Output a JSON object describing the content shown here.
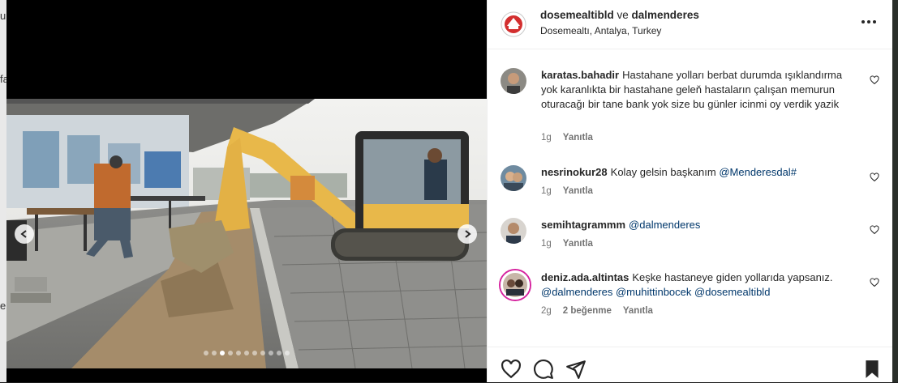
{
  "backdrop": {
    "glyphs": [
      "u",
      "fa",
      "e"
    ]
  },
  "media": {
    "carousel_dots_total": 11,
    "carousel_active_index": 2,
    "prev_label": "previous-slide",
    "next_label": "next-slide"
  },
  "header": {
    "author": "dosemealtibld",
    "conjunction": " ve ",
    "coauthor": "dalmenderes",
    "location": "Dosemealtı, Antalya, Turkey"
  },
  "comments": [
    {
      "username": "karatas.bahadir",
      "text": "Hastahane yolları berbat durumda ışıklandırma yok karanlıkta bir hastahane geleň hastaların çalışan memurun oturacağı bir tane bank yok size bu günler icinmi oy verdik yazik",
      "mentions": [],
      "time": "1g",
      "likes": "",
      "reply": "Yanıtla"
    },
    {
      "username": "nesrinokur28",
      "text": "Kolay gelsin başkanım ",
      "mentions": [
        "@Menderesdal#"
      ],
      "time": "1g",
      "likes": "",
      "reply": "Yanıtla"
    },
    {
      "username": "semihtagrammm",
      "text": "",
      "mentions": [
        "@dalmenderes"
      ],
      "time": "1g",
      "likes": "",
      "reply": "Yanıtla"
    },
    {
      "username": "deniz.ada.altintas",
      "text": "Keşke hastaneye giden yollarıda yapsanız. ",
      "mentions": [
        "@dalmenderes",
        "@muhittinbocek",
        "@dosemealtibld"
      ],
      "time": "2g",
      "likes": "2 beğenme",
      "reply": "Yanıtla"
    }
  ],
  "actions": {
    "like": "heart-icon",
    "comment": "comment-icon",
    "share": "share-icon",
    "save": "bookmark-icon"
  },
  "colors": {
    "mention": "#00376b",
    "meta": "#737373",
    "excavator": "#e8b84a"
  }
}
